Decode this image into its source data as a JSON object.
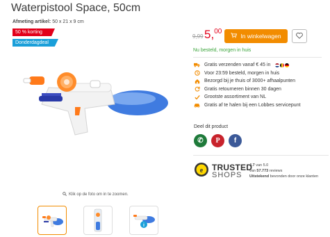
{
  "product": {
    "title": "Waterpistool Space, 50cm",
    "dims_label": "Afmeting artikel:",
    "dims_value": "50 x 21 x 9 cm"
  },
  "badges": {
    "discount": "50 % korting",
    "deal": "Donderdagdeal"
  },
  "price": {
    "old": "9,99",
    "new_main": "5,",
    "new_cents": "00"
  },
  "cart": {
    "label": "In winkelwagen"
  },
  "stock": "Nu besteld, morgen in huis",
  "usps": [
    {
      "icon": "delivery-truck-icon",
      "text": "Gratis verzenden vanaf € 45 in"
    },
    {
      "icon": "clock-icon",
      "text": "Voor 23:59 besteld, morgen in huis"
    },
    {
      "icon": "home-icon",
      "text": "Bezorgd bij je thuis of 3000+ afhaalpunten"
    },
    {
      "icon": "return-icon",
      "text": "Gratis retourneren binnen 30 dagen"
    },
    {
      "icon": "checkmark-icon",
      "text": "Grootste assortiment van NL"
    },
    {
      "icon": "pickup-car-icon",
      "text": "Gratis af te halen bij een Lobbes servicepunt"
    }
  ],
  "share": {
    "label": "Deel dit product",
    "whatsapp_glyph": "✆",
    "pinterest_glyph": "P",
    "facebook_glyph": "f"
  },
  "trusted_shops": {
    "brand_top": "TRUSTED",
    "brand_bottom": "SHOPS",
    "score": "4.7",
    "score_suffix": "van 5.0",
    "reviews_prefix": "van",
    "reviews_count": "57.773",
    "reviews_suffix": "reviews",
    "verdict": "Uitstekend",
    "verdict_suffix": "bevonden door onze klanten"
  },
  "gallery": {
    "zoom_hint": "Klik op de foto om in te zoomen."
  },
  "colors": {
    "accent": "#f28c00",
    "price_red": "#e2001a",
    "badge_blue": "#1a9fd9",
    "stock_green": "#3aa43a",
    "whatsapp": "#1e7a3a",
    "pinterest": "#c8232c",
    "facebook": "#3b5998"
  }
}
